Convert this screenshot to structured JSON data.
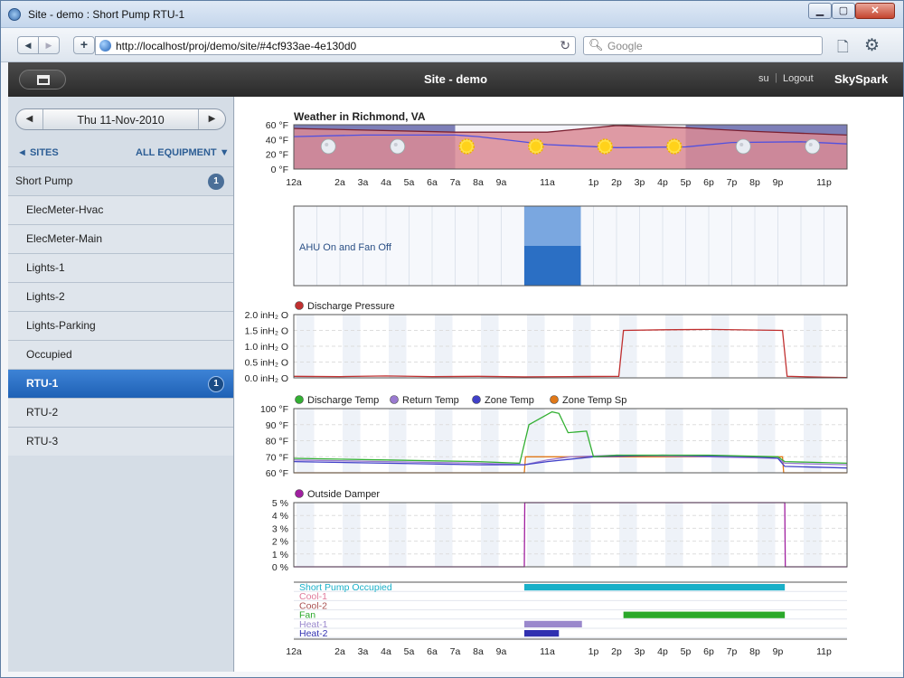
{
  "window": {
    "title": "Site - demo : Short Pump RTU-1",
    "min_label": "▁",
    "max_label": "▢",
    "close_label": "✕"
  },
  "browser": {
    "url": "http://localhost/proj/demo/site/#4cf933ae-4e130d0",
    "search_placeholder": "Google"
  },
  "app": {
    "title": "Site - demo",
    "user": "su",
    "separator": "|",
    "logout": "Logout",
    "brand": "SkySpark"
  },
  "sidebar": {
    "date": "Thu 11-Nov-2010",
    "sites_label": "◄ SITES",
    "all_equipment_label": "ALL EQUIPMENT ▼",
    "items": [
      {
        "label": "Short Pump",
        "badge": "1",
        "level": "top"
      },
      {
        "label": "ElecMeter-Hvac"
      },
      {
        "label": "ElecMeter-Main"
      },
      {
        "label": "Lights-1"
      },
      {
        "label": "Lights-2"
      },
      {
        "label": "Lights-Parking"
      },
      {
        "label": "Occupied"
      },
      {
        "label": "RTU-1",
        "badge": "1",
        "selected": true
      },
      {
        "label": "RTU-2"
      },
      {
        "label": "RTU-3"
      }
    ]
  },
  "charts": {
    "hours": [
      "12a",
      "",
      "2a",
      "3a",
      "4a",
      "5a",
      "6a",
      "7a",
      "8a",
      "9a",
      "",
      "11a",
      "",
      "1p",
      "2p",
      "3p",
      "4p",
      "5p",
      "6p",
      "7p",
      "8p",
      "9p",
      "",
      "11p"
    ],
    "colors": {
      "accent": "#2b6fc4",
      "discharge_pressure": "#c03030",
      "discharge_temp": "#33b033",
      "return_temp": "#9a7ad0",
      "zone_temp": "#4040c8",
      "zone_temp_sp": "#e07818",
      "outside_damper": "#a020a0",
      "weather_band": "#d98a94",
      "weather_line": "#5050e0"
    },
    "weather": {
      "title": "Weather in Richmond, VA",
      "ticks": [
        "60 °F",
        "40 °F",
        "20 °F",
        "0 °F"
      ],
      "ylim": [
        0,
        60
      ],
      "icons": [
        {
          "hour": 2,
          "kind": "moon"
        },
        {
          "hour": 5,
          "kind": "moon"
        },
        {
          "hour": 8,
          "kind": "sun"
        },
        {
          "hour": 11,
          "kind": "sun"
        },
        {
          "hour": 14,
          "kind": "sun"
        },
        {
          "hour": 17,
          "kind": "sun"
        },
        {
          "hour": 20,
          "kind": "moon"
        },
        {
          "hour": 23,
          "kind": "moon"
        }
      ],
      "temp_curve": [
        [
          0,
          44
        ],
        [
          3,
          46
        ],
        [
          7,
          46
        ],
        [
          8,
          44
        ],
        [
          11,
          33
        ],
        [
          14,
          29
        ],
        [
          17,
          30
        ],
        [
          19,
          36
        ],
        [
          22,
          37
        ],
        [
          24,
          34
        ]
      ],
      "high_curve": [
        [
          0,
          55
        ],
        [
          7,
          50
        ],
        [
          11,
          50
        ],
        [
          14,
          59
        ],
        [
          17,
          56
        ],
        [
          20,
          51
        ],
        [
          24,
          46
        ]
      ]
    },
    "ahu": {
      "label": "AHU On and Fan Off",
      "start": 10.0,
      "end": 12.45
    },
    "discharge_pressure": {
      "legend": "Discharge Pressure",
      "ticks": [
        "2.0 inH₂ O",
        "1.5 inH₂ O",
        "1.0 inH₂ O",
        "0.5 inH₂ O",
        "0.0 inH₂ O"
      ],
      "ylim": [
        0,
        2.0
      ],
      "series": [
        [
          0,
          0.05
        ],
        [
          2,
          0.04
        ],
        [
          4,
          0.06
        ],
        [
          6,
          0.04
        ],
        [
          8,
          0.05
        ],
        [
          10,
          0.03
        ],
        [
          12,
          0.04
        ],
        [
          14.1,
          0.05
        ],
        [
          14.3,
          1.5
        ],
        [
          16,
          1.52
        ],
        [
          18,
          1.53
        ],
        [
          21.2,
          1.5
        ],
        [
          21.4,
          0.05
        ],
        [
          23,
          0.02
        ],
        [
          24,
          0.01
        ]
      ]
    },
    "temps": {
      "legend": [
        "Discharge Temp",
        "Return Temp",
        "Zone Temp",
        "Zone Temp Sp"
      ],
      "ticks": [
        "100 °F",
        "90 °F",
        "80 °F",
        "70 °F",
        "60 °F"
      ],
      "ylim": [
        60,
        100
      ],
      "discharge": [
        [
          0,
          69
        ],
        [
          4,
          68
        ],
        [
          8,
          67
        ],
        [
          9.8,
          66
        ],
        [
          10.2,
          90
        ],
        [
          11.2,
          98
        ],
        [
          11.5,
          97
        ],
        [
          11.9,
          85
        ],
        [
          12.7,
          86
        ],
        [
          13.0,
          70
        ],
        [
          14,
          71
        ],
        [
          18,
          71
        ],
        [
          21,
          70
        ],
        [
          21.3,
          67
        ],
        [
          24,
          66
        ]
      ],
      "return": [
        [
          0,
          68
        ],
        [
          4,
          67
        ],
        [
          8,
          66
        ],
        [
          10,
          65
        ],
        [
          11,
          68
        ],
        [
          12,
          70
        ],
        [
          14,
          71
        ],
        [
          18,
          70
        ],
        [
          21,
          69
        ],
        [
          21.3,
          66
        ],
        [
          24,
          65
        ]
      ],
      "zone": [
        [
          0,
          67
        ],
        [
          4,
          66
        ],
        [
          8,
          65
        ],
        [
          10,
          65
        ],
        [
          11,
          67
        ],
        [
          13,
          70
        ],
        [
          16,
          71
        ],
        [
          20,
          70
        ],
        [
          21,
          69
        ],
        [
          21.3,
          64
        ],
        [
          24,
          63
        ]
      ],
      "zone_sp": [
        [
          0,
          60
        ],
        [
          10,
          60
        ],
        [
          10.05,
          70
        ],
        [
          21.2,
          70
        ],
        [
          21.25,
          60
        ],
        [
          24,
          60
        ]
      ]
    },
    "outside_damper": {
      "legend": "Outside Damper",
      "ticks": [
        "5 %",
        "4 %",
        "3 %",
        "2 %",
        "1 %",
        "0 %"
      ],
      "ylim": [
        0,
        5
      ],
      "series": [
        [
          0,
          0
        ],
        [
          10,
          0
        ],
        [
          10.02,
          5
        ],
        [
          21.3,
          5
        ],
        [
          21.32,
          0
        ],
        [
          24,
          0
        ]
      ]
    },
    "status": {
      "rows": [
        {
          "label": "Short Pump Occupied",
          "color": "#1ab0c8",
          "start": 10.0,
          "end": 21.3
        },
        {
          "label": "Cool-1",
          "color": "#e07a9a",
          "start": null,
          "end": null
        },
        {
          "label": "Cool-2",
          "color": "#a85050",
          "start": null,
          "end": null
        },
        {
          "label": "Fan",
          "color": "#2aa82a",
          "start": 14.3,
          "end": 21.3
        },
        {
          "label": "Heat-1",
          "color": "#9a88cc",
          "start": 10.0,
          "end": 12.5
        },
        {
          "label": "Heat-2",
          "color": "#3030b0",
          "start": 10.0,
          "end": 11.5
        }
      ]
    }
  }
}
